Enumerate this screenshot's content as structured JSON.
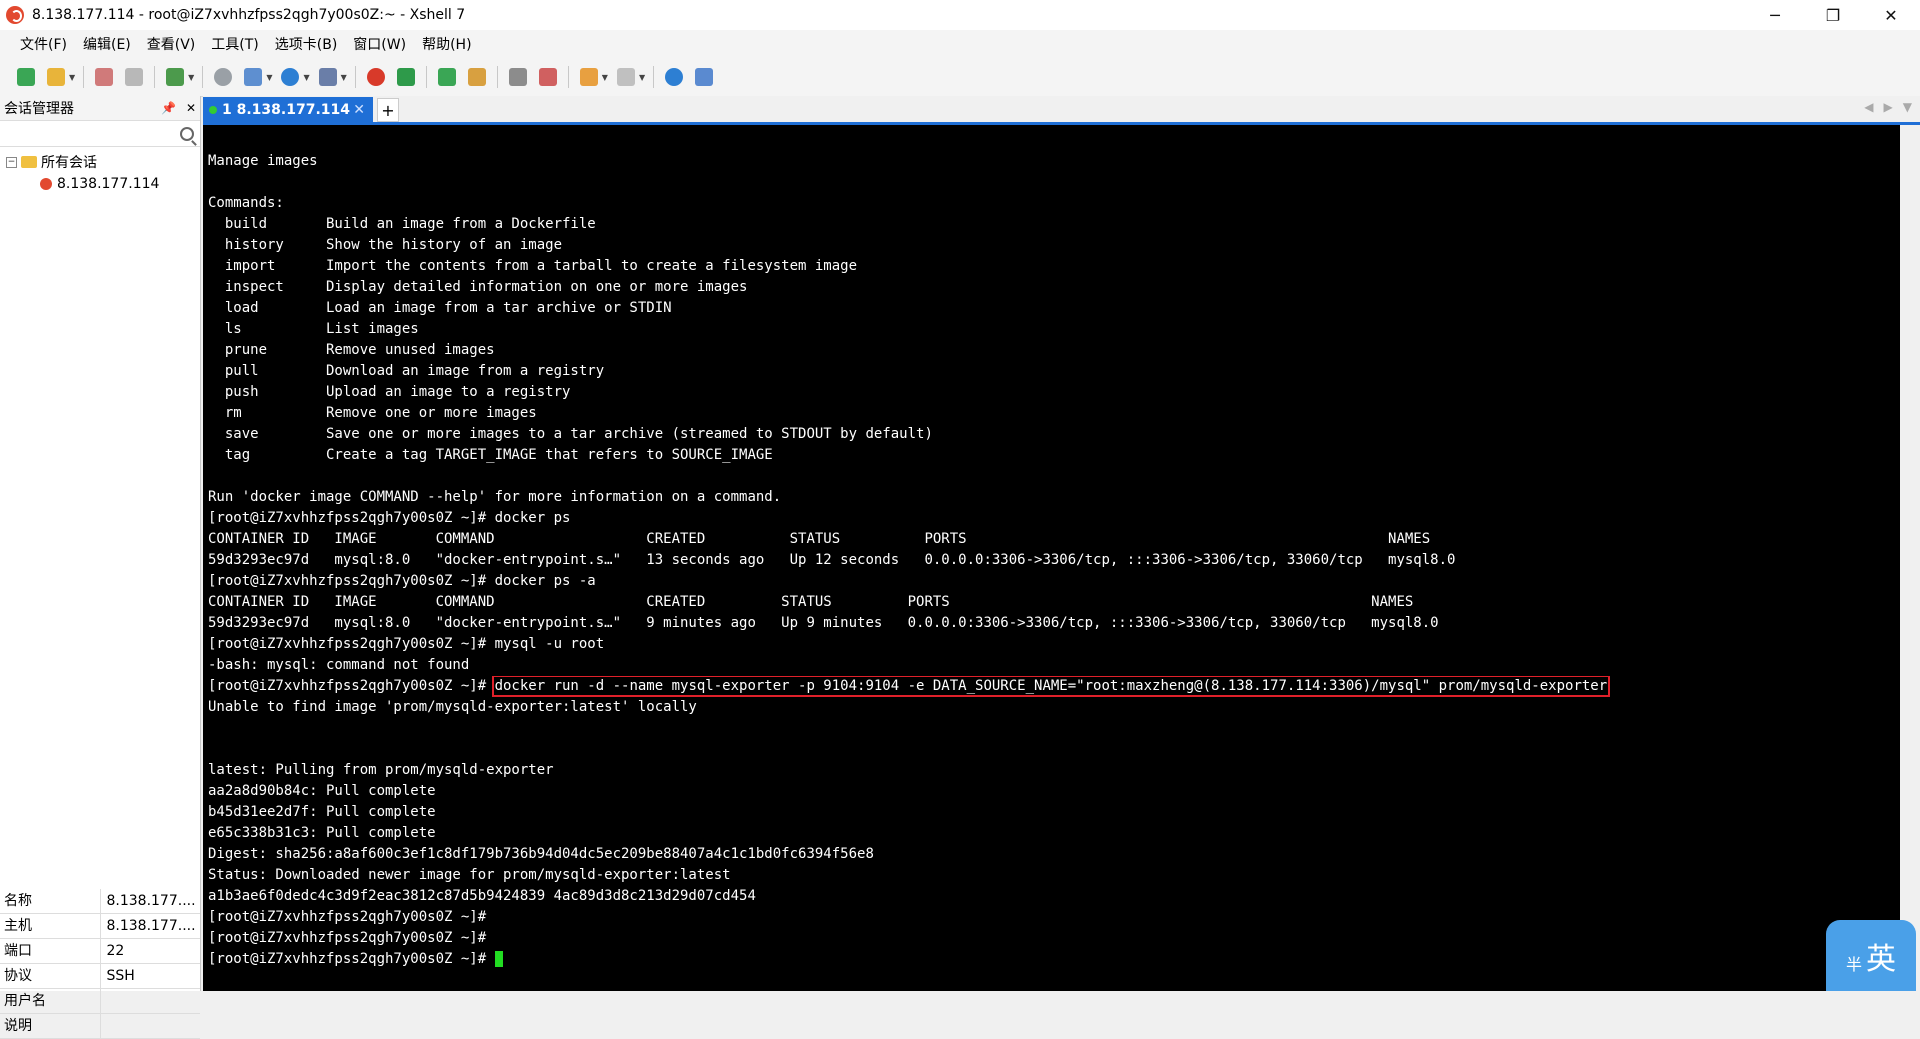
{
  "window": {
    "title": "8.138.177.114 - root@iZ7xvhhzfpss2qgh7y00s0Z:~ - Xshell 7",
    "min": "─",
    "max": "❐",
    "close": "✕"
  },
  "menu": [
    "文件(F)",
    "编辑(E)",
    "查看(V)",
    "工具(T)",
    "选项卡(B)",
    "窗口(W)",
    "帮助(H)"
  ],
  "sidebar": {
    "title": "会话管理器",
    "pin": "📌",
    "close": "✕",
    "search_placeholder": "",
    "tree": {
      "root": "所有会话",
      "expander": "−",
      "session": "8.138.177.114"
    },
    "properties": [
      {
        "key": "名称",
        "value": "8.138.177...."
      },
      {
        "key": "主机",
        "value": "8.138.177...."
      },
      {
        "key": "端口",
        "value": "22"
      },
      {
        "key": "协议",
        "value": "SSH"
      },
      {
        "key": "用户名",
        "value": ""
      },
      {
        "key": "说明",
        "value": ""
      }
    ]
  },
  "tabs": {
    "active_label": "1 8.138.177.114",
    "close": "✕",
    "add": "+",
    "nav_left": "◀",
    "nav_right": "▶",
    "menu": "▼"
  },
  "terminal": {
    "lines": [
      "Manage images",
      "",
      "Commands:",
      "  build       Build an image from a Dockerfile",
      "  history     Show the history of an image",
      "  import      Import the contents from a tarball to create a filesystem image",
      "  inspect     Display detailed information on one or more images",
      "  load        Load an image from a tar archive or STDIN",
      "  ls          List images",
      "  prune       Remove unused images",
      "  pull        Download an image from a registry",
      "  push        Upload an image to a registry",
      "  rm          Remove one or more images",
      "  save        Save one or more images to a tar archive (streamed to STDOUT by default)",
      "  tag         Create a tag TARGET_IMAGE that refers to SOURCE_IMAGE",
      "",
      "Run 'docker image COMMAND --help' for more information on a command.",
      "[root@iZ7xvhhzfpss2qgh7y00s0Z ~]# docker ps",
      "CONTAINER ID   IMAGE       COMMAND                  CREATED          STATUS          PORTS                                                  NAMES",
      "59d3293ec97d   mysql:8.0   \"docker-entrypoint.s…\"   13 seconds ago   Up 12 seconds   0.0.0.0:3306->3306/tcp, :::3306->3306/tcp, 33060/tcp   mysql8.0",
      "[root@iZ7xvhhzfpss2qgh7y00s0Z ~]# docker ps -a",
      "CONTAINER ID   IMAGE       COMMAND                  CREATED         STATUS         PORTS                                                  NAMES",
      "59d3293ec97d   mysql:8.0   \"docker-entrypoint.s…\"   9 minutes ago   Up 9 minutes   0.0.0.0:3306->3306/tcp, :::3306->3306/tcp, 33060/tcp   mysql8.0",
      "[root@iZ7xvhhzfpss2qgh7y00s0Z ~]# mysql -u root",
      "-bash: mysql: command not found"
    ],
    "highlight_prompt": "[root@iZ7xvhhzfpss2qgh7y00s0Z ~]# ",
    "highlight_command": "docker run -d --name mysql-exporter -p 9104:9104 -e DATA_SOURCE_NAME=\"root:maxzheng@(8.138.177.114:3306)/mysql\" prom/mysqld-exporter",
    "lines_after": [
      "Unable to find image 'prom/mysqld-exporter:latest' locally",
      "",
      "",
      "latest: Pulling from prom/mysqld-exporter",
      "aa2a8d90b84c: Pull complete",
      "b45d31ee2d7f: Pull complete",
      "e65c338b31c3: Pull complete",
      "Digest: sha256:a8af600c3ef1c8df179b736b94d04dc5ec209be88407a4c1c1bd0fc6394f56e8",
      "Status: Downloaded newer image for prom/mysqld-exporter:latest",
      "a1b3ae6f0dedc4c3d9f2eac3812c87d5b9424839 4ac89d3d8c213d29d07cd454",
      "[root@iZ7xvhhzfpss2qgh7y00s0Z ~]#",
      "[root@iZ7xvhhzfpss2qgh7y00s0Z ~]#"
    ],
    "last_prompt": "[root@iZ7xvhhzfpss2qgh7y00s0Z ~]# "
  },
  "ime": {
    "label": "英",
    "mode": "半"
  }
}
